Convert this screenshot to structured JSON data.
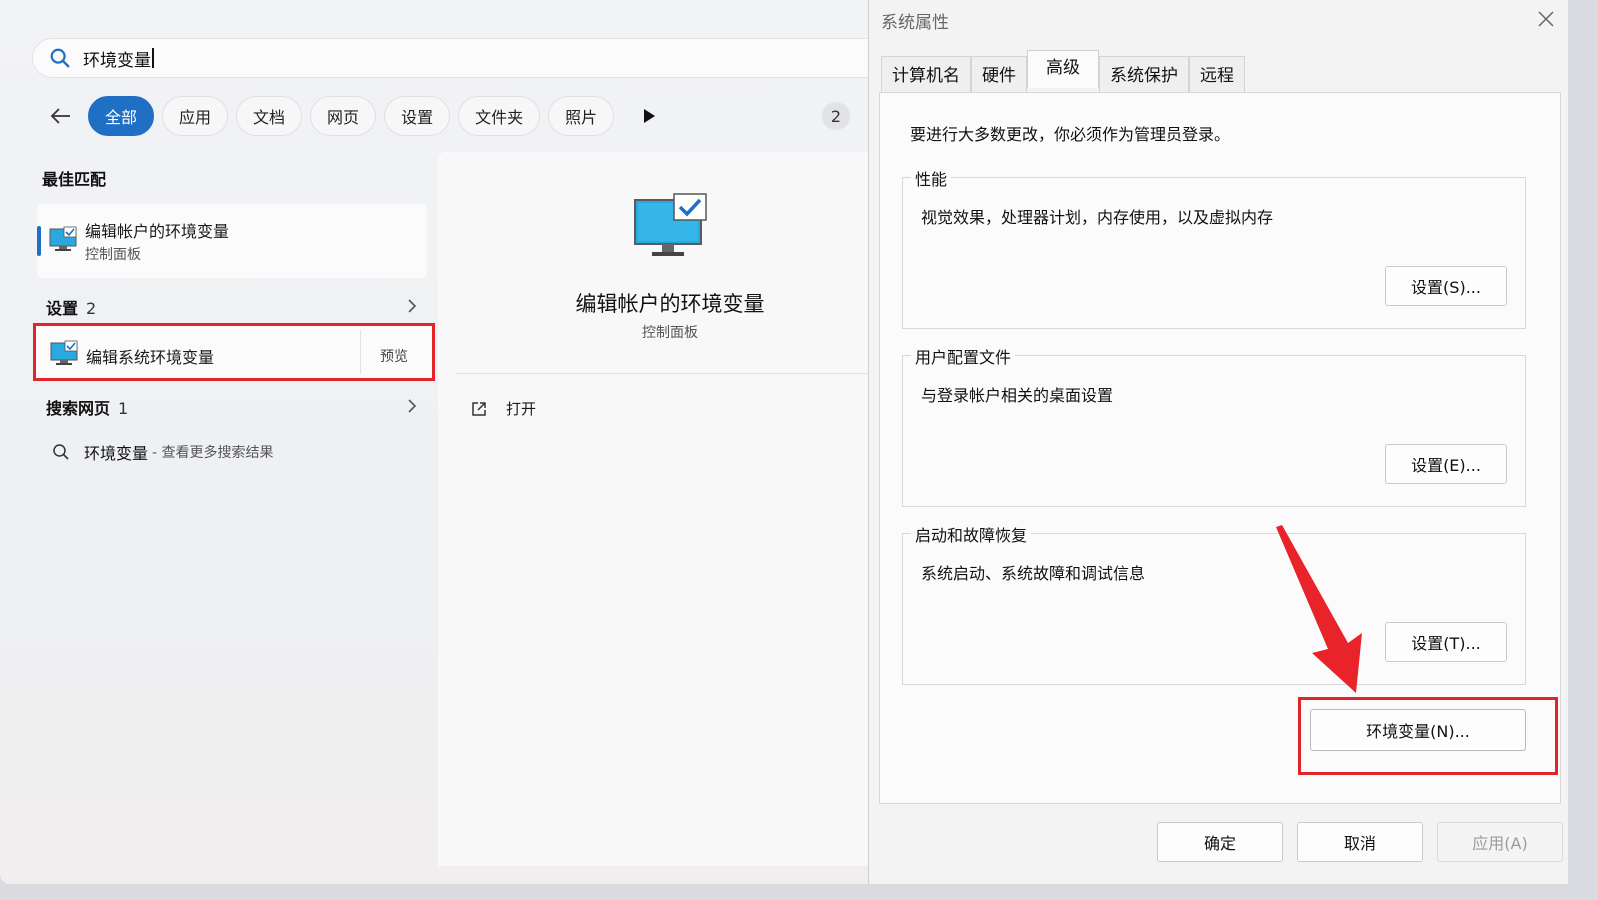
{
  "search": {
    "query": "环境变量",
    "filters": [
      "全部",
      "应用",
      "文档",
      "网页",
      "设置",
      "文件夹",
      "照片"
    ],
    "result_count_badge": "2"
  },
  "results": {
    "best_match_header": "最佳匹配",
    "best_match": {
      "title": "编辑帐户的环境变量",
      "subtitle": "控制面板"
    },
    "settings_header": "设置",
    "settings_count": "2",
    "settings_item": {
      "title": "编辑系统环境变量",
      "preview_label": "预览"
    },
    "web_header": "搜索网页",
    "web_count": "1",
    "web_item": {
      "query": "环境变量",
      "more": "- 查看更多搜索结果"
    }
  },
  "preview": {
    "title": "编辑帐户的环境变量",
    "subtitle": "控制面板",
    "open_label": "打开"
  },
  "dialog": {
    "title": "系统属性",
    "tabs": [
      "计算机名",
      "硬件",
      "高级",
      "系统保护",
      "远程"
    ],
    "active_tab": "高级",
    "admin_note": "要进行大多数更改，你必须作为管理员登录。",
    "groups": [
      {
        "legend": "性能",
        "desc": "视觉效果，处理器计划，内存使用，以及虚拟内存",
        "button": "设置(S)..."
      },
      {
        "legend": "用户配置文件",
        "desc": "与登录帐户相关的桌面设置",
        "button": "设置(E)..."
      },
      {
        "legend": "启动和故障恢复",
        "desc": "系统启动、系统故障和调试信息",
        "button": "设置(T)..."
      }
    ],
    "env_button": "环境变量(N)...",
    "ok": "确定",
    "cancel": "取消",
    "apply": "应用(A)"
  },
  "colors": {
    "accent": "#1f6fc4",
    "highlight": "#e0262a"
  }
}
